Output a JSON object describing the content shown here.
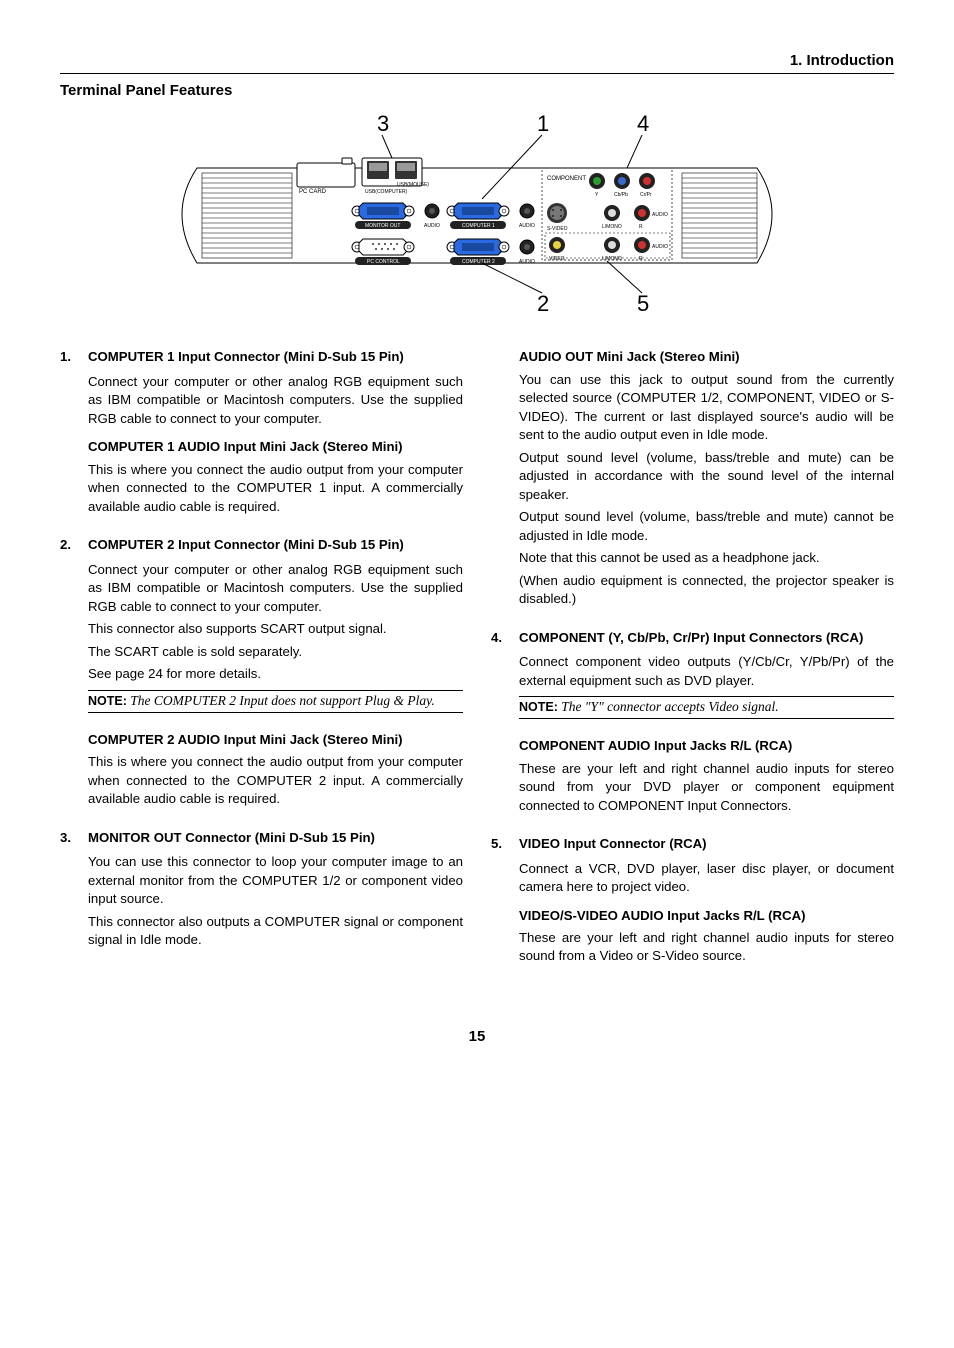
{
  "chapter": "1. Introduction",
  "section_title": "Terminal Panel Features",
  "pageNumber": "15",
  "callouts": {
    "c1": "1",
    "c2": "2",
    "c3": "3",
    "c4": "4",
    "c5": "5"
  },
  "panel": {
    "pc_card": "PC CARD",
    "usb_comp": "USB(COMPUTER)",
    "usb_mouse": "USB(MOUSE)",
    "monitor_out": "MONITOR OUT",
    "audio": "AUDIO",
    "computer1": "COMPUTER 1",
    "computer2": "COMPUTER 2",
    "pc_control": "PC CONTROL",
    "component": "COMPONENT",
    "y": "Y",
    "cbpb": "Cb/Pb",
    "crpr": "Cr/Pr",
    "svideo": "S-VIDEO",
    "video": "VIDEO",
    "lmono": "L/MONO",
    "r": "R"
  },
  "left": {
    "i1": {
      "title": "COMPUTER 1 Input Connector (Mini D-Sub 15 Pin)",
      "p1": "Connect your computer or other analog RGB equipment such as IBM compatible or Macintosh computers. Use the supplied RGB cable to connect to your computer.",
      "sub1": "COMPUTER 1 AUDIO Input Mini Jack (Stereo Mini)",
      "p2": "This is where you connect the audio output from your computer when connected to the COMPUTER 1 input. A commercially available audio cable is required."
    },
    "i2": {
      "title": "COMPUTER 2 Input Connector (Mini D-Sub 15 Pin)",
      "p1": "Connect your computer or other analog RGB equipment such as IBM compatible or Macintosh computers. Use the supplied RGB cable to connect to your computer.",
      "p2": "This connector also supports SCART output signal.",
      "p3": "The SCART cable is sold separately.",
      "p4": "See page 24 for more details.",
      "noteLabel": "NOTE:",
      "note": "The COMPUTER 2 Input does not support Plug & Play.",
      "sub1": "COMPUTER 2 AUDIO Input Mini Jack (Stereo Mini)",
      "p5": "This is where you connect the audio output from your computer when connected to the COMPUTER 2 input. A commercially available audio cable is required."
    },
    "i3": {
      "title": "MONITOR OUT Connector (Mini D-Sub 15 Pin)",
      "p1": "You can use this connector to loop your computer image to an external monitor from the COMPUTER 1/2 or component video input source.",
      "p2": "This connector also outputs a COMPUTER signal or component signal in Idle mode."
    }
  },
  "right": {
    "audioOut": {
      "sub": "AUDIO OUT Mini Jack (Stereo Mini)",
      "p1": "You can use this jack to output sound from the currently selected source (COMPUTER 1/2, COMPONENT, VIDEO or S-VIDEO). The current or last displayed source's audio will be sent to the audio output even in Idle mode.",
      "p2": "Output sound level (volume, bass/treble and mute) can be adjusted in accordance with the sound level of the internal speaker.",
      "p3": "Output sound level (volume, bass/treble and mute) cannot be adjusted in Idle mode.",
      "p4": "Note that this cannot be used as a headphone jack.",
      "p5": "(When audio equipment is connected, the projector speaker is disabled.)"
    },
    "i4": {
      "title": "COMPONENT (Y, Cb/Pb, Cr/Pr) Input Connectors (RCA)",
      "p1": "Connect component video outputs (Y/Cb/Cr, Y/Pb/Pr) of the external equipment such as DVD player.",
      "noteLabel": "NOTE:",
      "note": "The \"Y\" connector accepts Video signal.",
      "sub1": "COMPONENT AUDIO Input Jacks R/L (RCA)",
      "p2": "These are your left and right channel audio inputs for stereo sound from your DVD player or component equipment connected to COMPONENT Input Connectors."
    },
    "i5": {
      "title": "VIDEO Input Connector (RCA)",
      "p1": "Connect a VCR, DVD player, laser disc player, or document camera here to project video.",
      "sub1": "VIDEO/S-VIDEO AUDIO Input Jacks R/L (RCA)",
      "p2": "These are your left and right channel audio inputs for stereo sound from a Video or S-Video source."
    }
  }
}
